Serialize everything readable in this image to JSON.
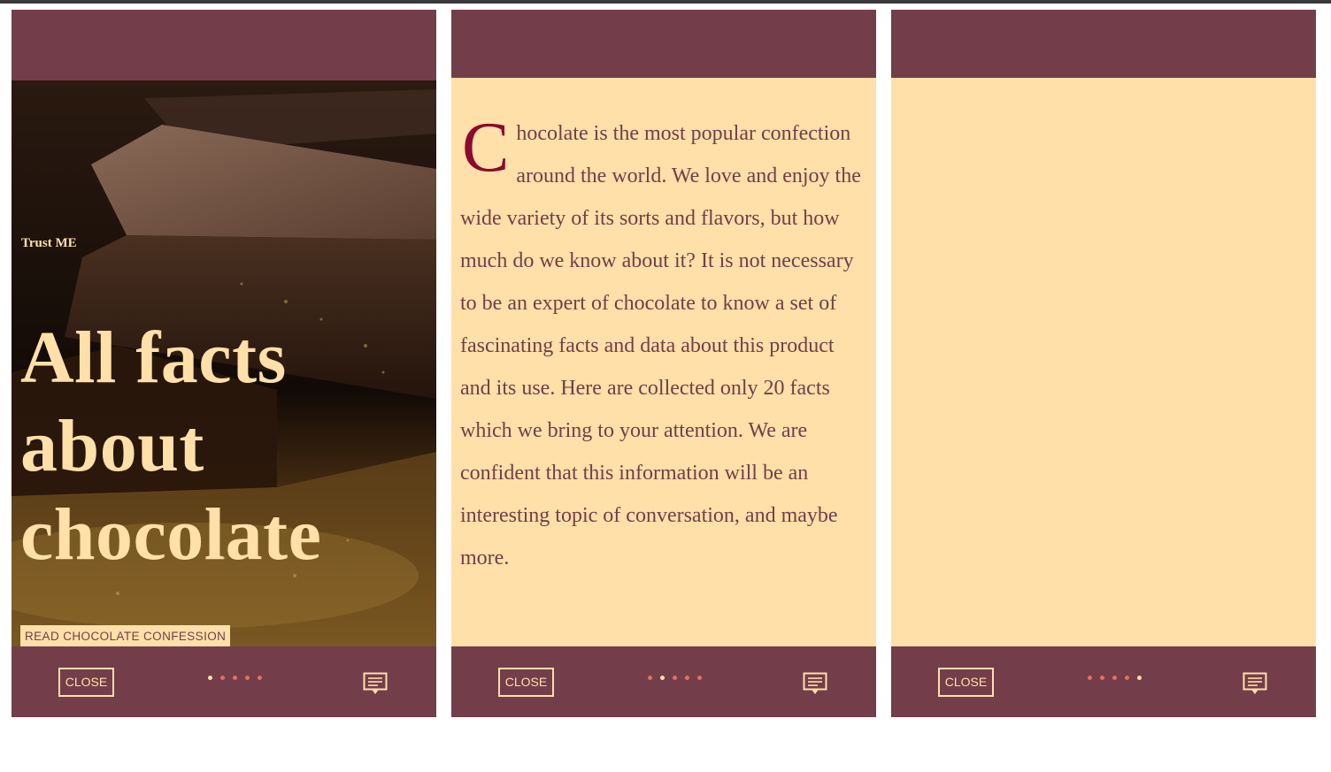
{
  "panels": [
    {
      "kicker": "Trust ME",
      "title_lines": [
        "All facts",
        "about",
        "chocolate"
      ],
      "cta_label": "READ CHOCOLATE CONFESSION",
      "close_label": "CLOSE",
      "active_dot": 0,
      "icon": "comment-icon"
    },
    {
      "dropcap": "C",
      "body": "hocolate is the most popular confection around the world. We love and enjoy the wide variety of its sorts and flavors, but how much do we know about it? It is not necessary to be an expert of chocolate to know a set of fascinating facts and data about this product and its use. Here are collected only 20 facts which we bring to your attention. We are confident that this information will be an interesting topic of conversation, and maybe more.",
      "close_label": "CLOSE",
      "active_dot": 1,
      "icon": "comment-icon"
    },
    {
      "close_label": "CLOSE",
      "active_dot": 4,
      "icon": "comment-icon"
    }
  ],
  "dot_count": 5,
  "colors": {
    "header": "#733d4a",
    "page": "#ffe0a8",
    "dot": "#e07060",
    "dropcap": "#8b0a2e"
  }
}
